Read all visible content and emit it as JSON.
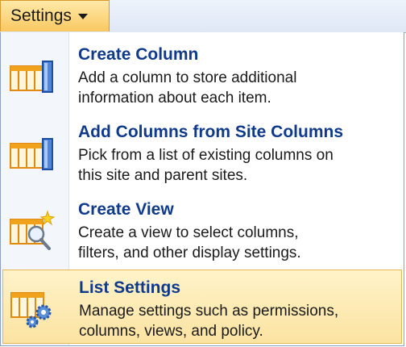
{
  "toolbar": {
    "settings_label": "Settings"
  },
  "menu": {
    "items": [
      {
        "title": "Create Column",
        "desc_line1": "Add a column to store additional",
        "desc_line2": "information about each item.",
        "icon": "columns-icon"
      },
      {
        "title": "Add Columns from Site Columns",
        "desc_line1": "Pick from a list of existing columns on",
        "desc_line2": "this site and parent sites.",
        "icon": "columns-icon"
      },
      {
        "title": "Create View",
        "desc_line1": "Create a view to select columns,",
        "desc_line2": "filters, and other display settings.",
        "icon": "view-magnifier-icon"
      },
      {
        "title": "List Settings",
        "desc_line1": "Manage settings such as permissions,",
        "desc_line2": "columns, views, and policy.",
        "icon": "settings-gears-icon"
      }
    ]
  },
  "colors": {
    "title_blue": "#0f3a8c",
    "hover_fill": "#fbe3a1",
    "icon_orange": "#f0a21b"
  }
}
